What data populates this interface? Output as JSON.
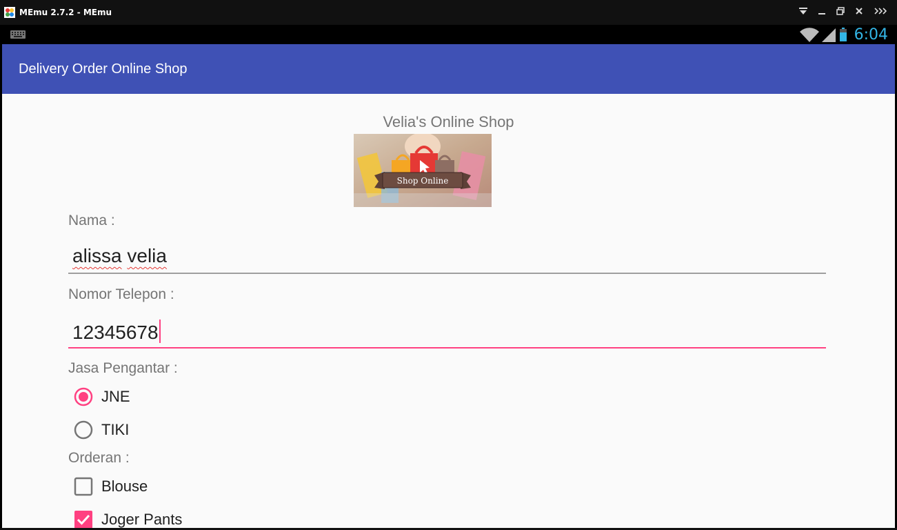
{
  "window": {
    "title": "MEmu 2.7.2 - MEmu",
    "controls": [
      "dropdown-icon",
      "minimize-icon",
      "restore-icon",
      "close-icon",
      "more-icon"
    ]
  },
  "statusbar": {
    "time": "6:04",
    "icons": [
      "keyboard-icon",
      "wifi-icon",
      "signal-icon",
      "battery-icon"
    ],
    "time_color": "#33b5e5"
  },
  "appbar": {
    "title": "Delivery Order Online Shop",
    "color": "#3f51b5"
  },
  "form": {
    "shop_title": "Velia's Online Shop",
    "banner_text": "Shop Online",
    "name": {
      "label": "Nama :",
      "value_words": [
        "alissa",
        "velia"
      ]
    },
    "phone": {
      "label": "Nomor Telepon :",
      "value": "12345678"
    },
    "courier": {
      "label": "Jasa Pengantar :",
      "options": [
        {
          "label": "JNE",
          "checked": true
        },
        {
          "label": "TIKI",
          "checked": false
        }
      ]
    },
    "order": {
      "label": "Orderan :",
      "items": [
        {
          "label": "Blouse",
          "checked": false
        },
        {
          "label": "Joger Pants",
          "checked": true
        }
      ]
    },
    "accent_color": "#ff4081"
  }
}
